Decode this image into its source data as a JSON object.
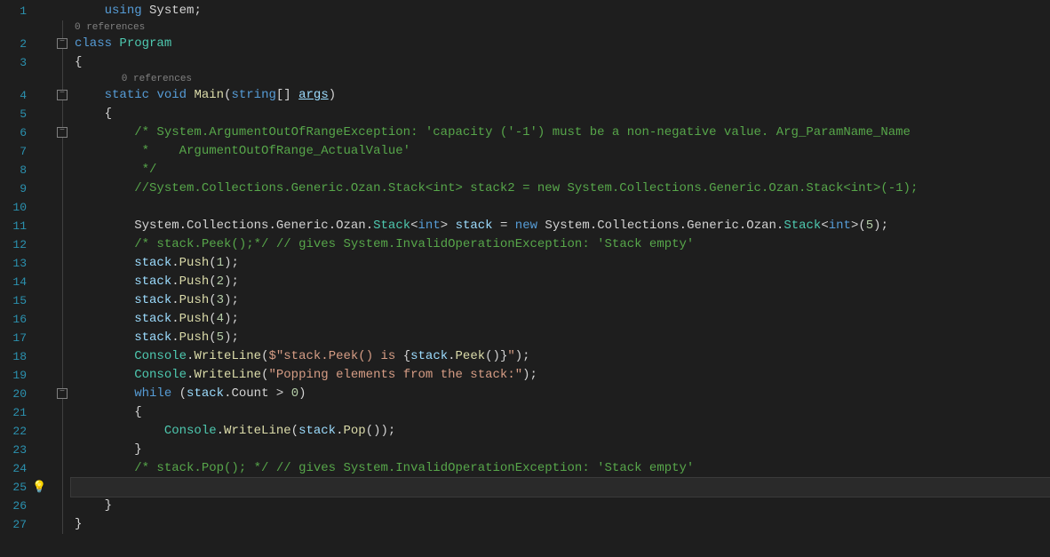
{
  "codelens": {
    "refs0": "0 references",
    "refs1": "0 references"
  },
  "lines": {
    "l1": {
      "n": "1",
      "t": [
        "    ",
        [
          "kw",
          "using"
        ],
        " ",
        [
          "ns",
          "System"
        ],
        [
          "punct",
          ";"
        ]
      ]
    },
    "cl1": "0 references",
    "l2": {
      "n": "2",
      "t": [
        [
          "kw",
          "class"
        ],
        " ",
        [
          "type",
          "Program"
        ]
      ]
    },
    "l3": {
      "n": "3",
      "t": [
        [
          "punct",
          "{"
        ]
      ]
    },
    "cl2": "    0 references",
    "l4": {
      "n": "4",
      "t": [
        "    ",
        [
          "kw",
          "static"
        ],
        " ",
        [
          "kw",
          "void"
        ],
        " ",
        [
          "method",
          "Main"
        ],
        [
          "punct",
          "("
        ],
        [
          "kw",
          "string"
        ],
        [
          "punct",
          "[]"
        ],
        " ",
        [
          "param underline",
          "args"
        ],
        [
          "punct",
          ")"
        ]
      ]
    },
    "l5": {
      "n": "5",
      "t": [
        "    ",
        [
          "punct",
          "{"
        ]
      ]
    },
    "l6": {
      "n": "6",
      "t": [
        "        ",
        [
          "comment",
          "/* System.ArgumentOutOfRangeException: 'capacity ('-1') must be a non-negative value. Arg_ParamName_Name"
        ]
      ]
    },
    "l7": {
      "n": "7",
      "t": [
        "        ",
        [
          "comment",
          " *    ArgumentOutOfRange_ActualValue'"
        ]
      ]
    },
    "l8": {
      "n": "8",
      "t": [
        "        ",
        [
          "comment",
          " */"
        ]
      ]
    },
    "l9": {
      "n": "9",
      "t": [
        "        ",
        [
          "comment",
          "//System.Collections.Generic.Ozan.Stack<int> stack2 = new System.Collections.Generic.Ozan.Stack<int>(-1);"
        ]
      ]
    },
    "l10": {
      "n": "10",
      "t": [
        ""
      ]
    },
    "l11": {
      "n": "11",
      "t": [
        "        ",
        [
          "ns",
          "System"
        ],
        [
          "punct",
          "."
        ],
        [
          "ns",
          "Collections"
        ],
        [
          "punct",
          "."
        ],
        [
          "ns",
          "Generic"
        ],
        [
          "punct",
          "."
        ],
        [
          "ns",
          "Ozan"
        ],
        [
          "punct",
          "."
        ],
        [
          "type",
          "Stack"
        ],
        [
          "punct",
          "<"
        ],
        [
          "kw",
          "int"
        ],
        [
          "punct",
          ">"
        ],
        " ",
        [
          "local",
          "stack"
        ],
        " ",
        [
          "op",
          "="
        ],
        " ",
        [
          "kw",
          "new"
        ],
        " ",
        [
          "ns",
          "System"
        ],
        [
          "punct",
          "."
        ],
        [
          "ns",
          "Collections"
        ],
        [
          "punct",
          "."
        ],
        [
          "ns",
          "Generic"
        ],
        [
          "punct",
          "."
        ],
        [
          "ns",
          "Ozan"
        ],
        [
          "punct",
          "."
        ],
        [
          "type",
          "Stack"
        ],
        [
          "punct",
          "<"
        ],
        [
          "kw",
          "int"
        ],
        [
          "punct",
          ">("
        ],
        [
          "num",
          "5"
        ],
        [
          "punct",
          ");"
        ]
      ]
    },
    "l12": {
      "n": "12",
      "t": [
        "        ",
        [
          "comment",
          "/* stack.Peek();*/"
        ],
        " ",
        [
          "comment",
          "// gives System.InvalidOperationException: 'Stack empty'"
        ]
      ]
    },
    "l13": {
      "n": "13",
      "t": [
        "        ",
        [
          "local",
          "stack"
        ],
        [
          "punct",
          "."
        ],
        [
          "method",
          "Push"
        ],
        [
          "punct",
          "("
        ],
        [
          "num",
          "1"
        ],
        [
          "punct",
          ");"
        ]
      ]
    },
    "l14": {
      "n": "14",
      "t": [
        "        ",
        [
          "local",
          "stack"
        ],
        [
          "punct",
          "."
        ],
        [
          "method",
          "Push"
        ],
        [
          "punct",
          "("
        ],
        [
          "num",
          "2"
        ],
        [
          "punct",
          ");"
        ]
      ]
    },
    "l15": {
      "n": "15",
      "t": [
        "        ",
        [
          "local",
          "stack"
        ],
        [
          "punct",
          "."
        ],
        [
          "method",
          "Push"
        ],
        [
          "punct",
          "("
        ],
        [
          "num",
          "3"
        ],
        [
          "punct",
          ");"
        ]
      ]
    },
    "l16": {
      "n": "16",
      "t": [
        "        ",
        [
          "local",
          "stack"
        ],
        [
          "punct",
          "."
        ],
        [
          "method",
          "Push"
        ],
        [
          "punct",
          "("
        ],
        [
          "num",
          "4"
        ],
        [
          "punct",
          ");"
        ]
      ]
    },
    "l17": {
      "n": "17",
      "t": [
        "        ",
        [
          "local",
          "stack"
        ],
        [
          "punct",
          "."
        ],
        [
          "method",
          "Push"
        ],
        [
          "punct",
          "("
        ],
        [
          "num",
          "5"
        ],
        [
          "punct",
          ");"
        ]
      ]
    },
    "l18": {
      "n": "18",
      "t": [
        "        ",
        [
          "type",
          "Console"
        ],
        [
          "punct",
          "."
        ],
        [
          "method",
          "WriteLine"
        ],
        [
          "punct",
          "("
        ],
        [
          "str",
          "$\""
        ],
        [
          "str",
          "stack.Peek() is "
        ],
        [
          "punct",
          "{"
        ],
        [
          "local",
          "stack"
        ],
        [
          "punct",
          "."
        ],
        [
          "method",
          "Peek"
        ],
        [
          "punct",
          "()}"
        ],
        [
          "str",
          "\""
        ],
        [
          "punct",
          ");"
        ]
      ]
    },
    "l19": {
      "n": "19",
      "t": [
        "        ",
        [
          "type",
          "Console"
        ],
        [
          "punct",
          "."
        ],
        [
          "method",
          "WriteLine"
        ],
        [
          "punct",
          "("
        ],
        [
          "str",
          "\"Popping elements from the stack:\""
        ],
        [
          "punct",
          ");"
        ]
      ]
    },
    "l20": {
      "n": "20",
      "t": [
        "        ",
        [
          "kw",
          "while"
        ],
        " ",
        [
          "punct",
          "("
        ],
        [
          "local",
          "stack"
        ],
        [
          "punct",
          "."
        ],
        [
          "ns",
          "Count"
        ],
        " ",
        [
          "op",
          ">"
        ],
        " ",
        [
          "num",
          "0"
        ],
        [
          "punct",
          ")"
        ]
      ]
    },
    "l21": {
      "n": "21",
      "t": [
        "        ",
        [
          "punct",
          "{"
        ]
      ]
    },
    "l22": {
      "n": "22",
      "t": [
        "            ",
        [
          "type",
          "Console"
        ],
        [
          "punct",
          "."
        ],
        [
          "method",
          "WriteLine"
        ],
        [
          "punct",
          "("
        ],
        [
          "local",
          "stack"
        ],
        [
          "punct",
          "."
        ],
        [
          "method",
          "Pop"
        ],
        [
          "punct",
          "());"
        ]
      ]
    },
    "l23": {
      "n": "23",
      "t": [
        "        ",
        [
          "punct",
          "}"
        ]
      ]
    },
    "l24": {
      "n": "24",
      "t": [
        "        ",
        [
          "comment",
          "/* stack.Pop(); */"
        ],
        " ",
        [
          "comment",
          "// gives System.InvalidOperationException: 'Stack empty'"
        ]
      ]
    },
    "l25": {
      "n": "25",
      "t": [
        ""
      ]
    },
    "l26": {
      "n": "26",
      "t": [
        "    ",
        [
          "punct",
          "}"
        ]
      ]
    },
    "l27": {
      "n": "27",
      "t": [
        [
          "punct",
          "}"
        ]
      ]
    }
  },
  "rows": [
    {
      "type": "code",
      "key": "l1",
      "fold": ""
    },
    {
      "type": "lens",
      "key": "cl1",
      "indent": ""
    },
    {
      "type": "code",
      "key": "l2",
      "fold": "box"
    },
    {
      "type": "code",
      "key": "l3",
      "fold": "line"
    },
    {
      "type": "lens",
      "key": "cl2",
      "indent": "    "
    },
    {
      "type": "code",
      "key": "l4",
      "fold": "box"
    },
    {
      "type": "code",
      "key": "l5",
      "fold": "line"
    },
    {
      "type": "code",
      "key": "l6",
      "fold": "box"
    },
    {
      "type": "code",
      "key": "l7",
      "fold": "line"
    },
    {
      "type": "code",
      "key": "l8",
      "fold": "line"
    },
    {
      "type": "code",
      "key": "l9",
      "fold": "line"
    },
    {
      "type": "code",
      "key": "l10",
      "fold": "line"
    },
    {
      "type": "code",
      "key": "l11",
      "fold": "line"
    },
    {
      "type": "code",
      "key": "l12",
      "fold": "line"
    },
    {
      "type": "code",
      "key": "l13",
      "fold": "line"
    },
    {
      "type": "code",
      "key": "l14",
      "fold": "line"
    },
    {
      "type": "code",
      "key": "l15",
      "fold": "line"
    },
    {
      "type": "code",
      "key": "l16",
      "fold": "line"
    },
    {
      "type": "code",
      "key": "l17",
      "fold": "line"
    },
    {
      "type": "code",
      "key": "l18",
      "fold": "line"
    },
    {
      "type": "code",
      "key": "l19",
      "fold": "line"
    },
    {
      "type": "code",
      "key": "l20",
      "fold": "box"
    },
    {
      "type": "code",
      "key": "l21",
      "fold": "line"
    },
    {
      "type": "code",
      "key": "l22",
      "fold": "line"
    },
    {
      "type": "code",
      "key": "l23",
      "fold": "line"
    },
    {
      "type": "code",
      "key": "l24",
      "fold": "line"
    },
    {
      "type": "code",
      "key": "l25",
      "fold": "line",
      "current": true,
      "bulb": true
    },
    {
      "type": "code",
      "key": "l26",
      "fold": "line"
    },
    {
      "type": "code",
      "key": "l27",
      "fold": "line"
    }
  ]
}
